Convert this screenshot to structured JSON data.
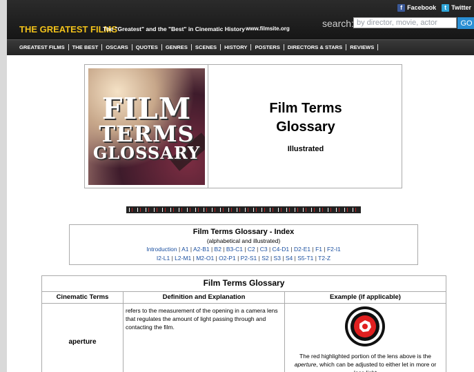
{
  "header": {
    "social": [
      {
        "label": "Facebook",
        "icon": "facebook-icon"
      },
      {
        "label": "Twitter",
        "icon": "twitter-icon"
      }
    ],
    "brand": "THE GREATEST FILMS",
    "tagline": "The \"Greatest\" and the \"Best\" in Cinematic History",
    "site": "www.filmsite.org",
    "search_label": "search:",
    "search_placeholder": "by director, movie, actor",
    "go_label": "GO"
  },
  "nav": {
    "items": [
      "GREATEST FILMS",
      "THE BEST",
      "OSCARS",
      "QUOTES",
      "GENRES",
      "SCENES",
      "HISTORY",
      "POSTERS",
      "DIRECTORS & STARS",
      "REVIEWS"
    ]
  },
  "hero": {
    "image_lines": [
      "FILM",
      "TERMS",
      "GLOSSARY"
    ],
    "title_line1": "Film Terms",
    "title_line2": "Glossary",
    "subtitle": "Illustrated"
  },
  "index": {
    "title": "Film Terms Glossary - Index",
    "subtitle": "(alphabetical and illustrated)",
    "links_row1": [
      "Introduction",
      "A1",
      "A2-B1",
      "B2",
      "B3-C1",
      "C2",
      "C3",
      "C4-D1",
      "D2-E1",
      "F1",
      "F2-I1"
    ],
    "links_row2": [
      "I2-L1",
      "L2-M1",
      "M2-O1",
      "O2-P1",
      "P2-S1",
      "S2",
      "S3",
      "S4",
      "S5-T1",
      "T2-Z"
    ]
  },
  "glossary": {
    "title": "Film Terms Glossary",
    "headers": [
      "Cinematic Terms",
      "Definition and Explanation",
      "Example (if applicable)"
    ],
    "rows": [
      {
        "term": "aperture",
        "definition": "refers to the measurement of the opening in a camera lens that regulates the amount of light passing through and contacting the film.",
        "example_pre": "The red highlighted portion of the lens above is the ",
        "example_em": "aperture",
        "example_post": ", which can be adjusted to either let in more or less light"
      }
    ]
  },
  "colors": {
    "brand": "#f2c21a",
    "go_button": "#2a8fd4",
    "link": "#1a4fa0",
    "lens_red": "#e02020"
  }
}
